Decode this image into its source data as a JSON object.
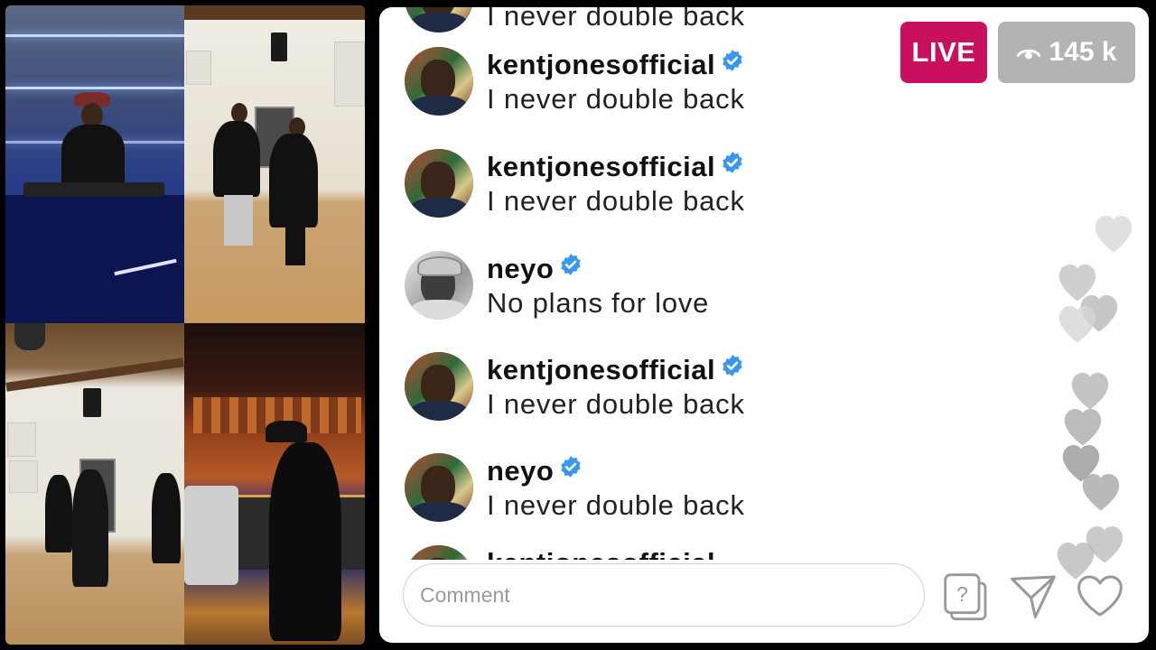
{
  "live": {
    "badge_label": "LIVE",
    "viewer_count": "145 k"
  },
  "messages": [
    {
      "user": "kentjonesofficial",
      "text": "I never double back",
      "verified": true,
      "avatar": "kentjones-avatar"
    },
    {
      "user": "kentjonesofficial",
      "text": "I never double back",
      "verified": true,
      "avatar": "kentjones-avatar"
    },
    {
      "user": "neyo",
      "text": "No plans for love",
      "verified": true,
      "avatar": "neyo-avatar"
    },
    {
      "user": "kentjonesofficial",
      "text": "I never double back",
      "verified": true,
      "avatar": "kentjones-avatar"
    },
    {
      "user": "neyo",
      "text": "I never double back",
      "verified": true,
      "avatar": "kentjones-avatar"
    }
  ],
  "partial_top": {
    "text": "I never double back"
  },
  "partial_bottom": {
    "user": "kentjonesofficial"
  },
  "comment": {
    "placeholder": "Comment"
  },
  "icons": {
    "question": "question-sticker-icon",
    "send": "send-icon",
    "like": "heart-icon",
    "viewers": "eye-icon",
    "verified": "verified-badge-icon"
  },
  "colors": {
    "live_badge": "#c8105f",
    "viewer_badge": "#b3b3b3",
    "verified": "#3897f0",
    "panel_bg": "#ffffff",
    "heart": "#b5b5b5"
  }
}
